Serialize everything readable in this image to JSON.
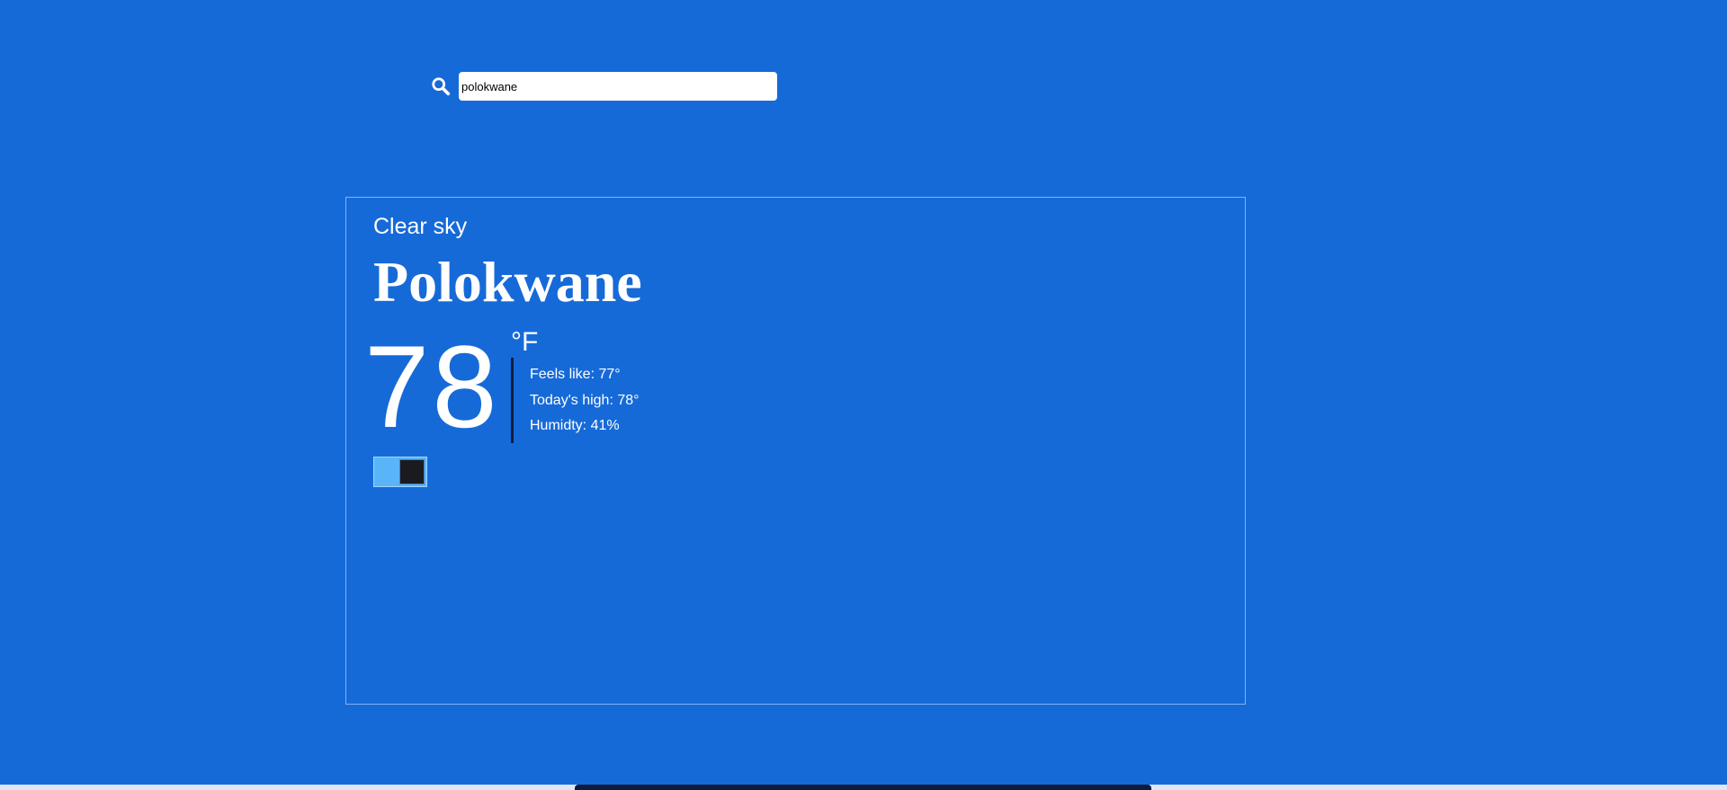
{
  "search": {
    "icon": "search-icon",
    "value": "polokwane",
    "placeholder": ""
  },
  "weather": {
    "condition": "Clear sky",
    "city": "Polokwane",
    "temperature": "78",
    "unit": "°F",
    "details": [
      "Feels like: 77°",
      "Today's high: 78°",
      "Humidty: 41%"
    ]
  },
  "unit_toggle": {
    "state": "on"
  },
  "colors": {
    "background": "#166ad8",
    "card_border": "#7fb3f0",
    "toggle_track": "#5ab5f8",
    "toggle_knob": "#1b1b1f",
    "divider": "#0f1b3a"
  }
}
